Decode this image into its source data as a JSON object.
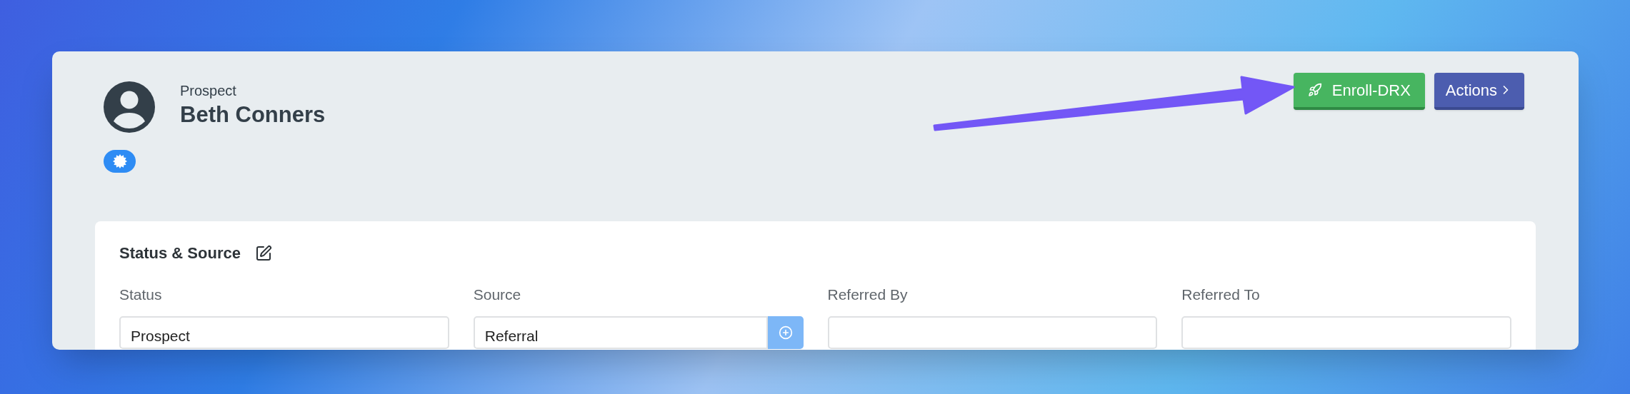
{
  "header": {
    "subtitle": "Prospect",
    "name": "Beth Conners"
  },
  "buttons": [
    {
      "label": "Enroll-DRX",
      "kind": "enroll"
    },
    {
      "label": "Actions",
      "kind": "actions"
    }
  ],
  "section": {
    "title": "Status & Source",
    "fields": [
      {
        "label": "Status",
        "value": "Prospect",
        "kind": "plain"
      },
      {
        "label": "Source",
        "value": "Referral",
        "kind": "add"
      },
      {
        "label": "Referred By",
        "kind": "plain"
      },
      {
        "label": "Referred To",
        "kind": "plain"
      }
    ]
  }
}
